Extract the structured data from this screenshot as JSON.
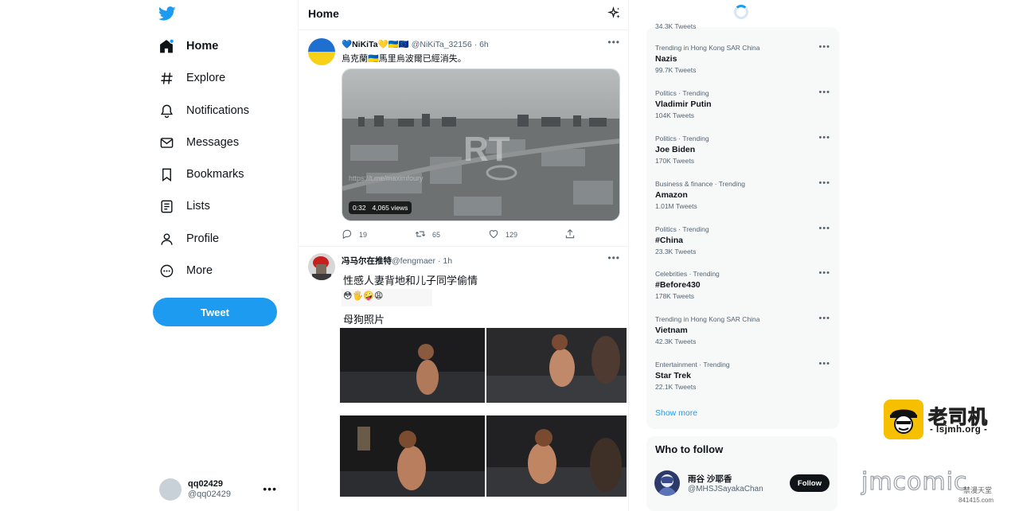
{
  "colors": {
    "accent": "#1d9bf0",
    "text": "#0f1419",
    "muted": "#536471",
    "panel": "#f7f9f9"
  },
  "sidebar": {
    "logo_icon": "twitter-bird-icon",
    "items": [
      {
        "label": "Home",
        "icon": "home-icon",
        "active": true
      },
      {
        "label": "Explore",
        "icon": "hashtag-icon"
      },
      {
        "label": "Notifications",
        "icon": "bell-icon"
      },
      {
        "label": "Messages",
        "icon": "envelope-icon"
      },
      {
        "label": "Bookmarks",
        "icon": "bookmark-icon"
      },
      {
        "label": "Lists",
        "icon": "list-icon"
      },
      {
        "label": "Profile",
        "icon": "person-icon"
      },
      {
        "label": "More",
        "icon": "more-circle-icon"
      }
    ],
    "tweet_label": "Tweet",
    "account": {
      "name": "qq02429",
      "handle": "@qq02429"
    }
  },
  "timeline": {
    "title": "Home",
    "tweets": [
      {
        "display_name": "💙NiKiTa💛🇺🇦🇪🇺",
        "handle": "@NiKiTa_32156",
        "time": "6h",
        "text": "烏克蘭🇺🇦馬里烏波爾已經消失。",
        "video": {
          "duration": "0:32",
          "views": "4,065 views",
          "overlay_mark": "RT",
          "overlay_url": "https://t.me/maximfoury"
        },
        "replies": "19",
        "retweets": "65",
        "likes": "129"
      },
      {
        "display_name": "冯马尔在推特",
        "handle": "@fengmaer",
        "time": "1h",
        "text": "性感人妻背地和儿子同学偷情",
        "emojis": "😳🖐️🤪😩",
        "text2": "母狗照片"
      }
    ]
  },
  "trends": {
    "top_partial": "34.3K Tweets",
    "items": [
      {
        "context": "Trending in Hong Kong SAR China",
        "name": "Nazis",
        "count": "99.7K Tweets"
      },
      {
        "context": "Politics · Trending",
        "name": "Vladimir Putin",
        "count": "104K Tweets"
      },
      {
        "context": "Politics · Trending",
        "name": "Joe Biden",
        "count": "170K Tweets"
      },
      {
        "context": "Business & finance · Trending",
        "name": "Amazon",
        "count": "1.01M Tweets"
      },
      {
        "context": "Politics · Trending",
        "name": "#China",
        "count": "23.3K Tweets"
      },
      {
        "context": "Celebrities · Trending",
        "name": "#Before430",
        "count": "178K Tweets"
      },
      {
        "context": "Trending in Hong Kong SAR China",
        "name": "Vietnam",
        "count": "42.3K Tweets"
      },
      {
        "context": "Entertainment · Trending",
        "name": "Star Trek",
        "count": "22.1K Tweets"
      }
    ],
    "show_more": "Show more"
  },
  "who_to_follow": {
    "title": "Who to follow",
    "user": {
      "name": "雨谷 沙耶香",
      "handle": "@MHSJSayakaChan",
      "follow_label": "Follow"
    }
  },
  "watermarks": {
    "brand1": "老司机",
    "domain1": "- lsjmh.org -",
    "brand2": "jmcomic",
    "sub2": "禁漫天堂",
    "sub2b": "18comic",
    "sub2c": "841415.com"
  }
}
